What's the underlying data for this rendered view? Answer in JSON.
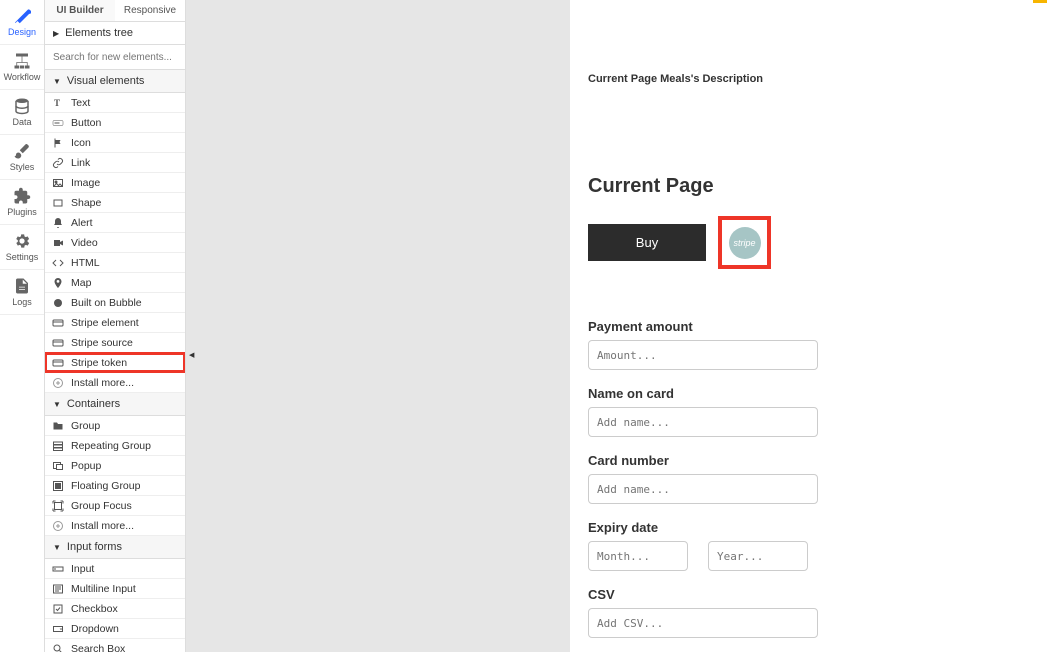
{
  "leftRail": [
    {
      "label": "Design",
      "icon": "tools",
      "active": true
    },
    {
      "label": "Workflow",
      "icon": "flow"
    },
    {
      "label": "Data",
      "icon": "database"
    },
    {
      "label": "Styles",
      "icon": "brush"
    },
    {
      "label": "Plugins",
      "icon": "puzzle"
    },
    {
      "label": "Settings",
      "icon": "gear"
    },
    {
      "label": "Logs",
      "icon": "file"
    }
  ],
  "tabs": {
    "uiBuilder": "UI Builder",
    "responsive": "Responsive"
  },
  "elementsTree": "Elements tree",
  "searchPlaceholder": "Search for new elements...",
  "groups": {
    "visual": "Visual elements",
    "containers": "Containers",
    "inputs": "Input forms"
  },
  "visualItems": [
    {
      "label": "Text",
      "icon": "text"
    },
    {
      "label": "Button",
      "icon": "button"
    },
    {
      "label": "Icon",
      "icon": "flag"
    },
    {
      "label": "Link",
      "icon": "link"
    },
    {
      "label": "Image",
      "icon": "image"
    },
    {
      "label": "Shape",
      "icon": "rect"
    },
    {
      "label": "Alert",
      "icon": "bell"
    },
    {
      "label": "Video",
      "icon": "video"
    },
    {
      "label": "HTML",
      "icon": "code"
    },
    {
      "label": "Map",
      "icon": "pin"
    },
    {
      "label": "Built on Bubble",
      "icon": "bubble"
    },
    {
      "label": "Stripe element",
      "icon": "card"
    },
    {
      "label": "Stripe source",
      "icon": "card"
    },
    {
      "label": "Stripe token",
      "icon": "card",
      "highlight": true
    },
    {
      "label": "Install more...",
      "icon": "plus"
    }
  ],
  "containerItems": [
    {
      "label": "Group",
      "icon": "folder"
    },
    {
      "label": "Repeating Group",
      "icon": "rgroup"
    },
    {
      "label": "Popup",
      "icon": "popup"
    },
    {
      "label": "Floating Group",
      "icon": "fgroup"
    },
    {
      "label": "Group Focus",
      "icon": "focus"
    },
    {
      "label": "Install more...",
      "icon": "plus"
    }
  ],
  "inputItems": [
    {
      "label": "Input",
      "icon": "input"
    },
    {
      "label": "Multiline Input",
      "icon": "mlinput"
    },
    {
      "label": "Checkbox",
      "icon": "check"
    },
    {
      "label": "Dropdown",
      "icon": "dropdown"
    },
    {
      "label": "Search Box",
      "icon": "search"
    }
  ],
  "canvas": {
    "description": "Current Page Meals's Description",
    "heading": "Current Page",
    "buy": "Buy",
    "stripeBadge": "stripe",
    "fields": {
      "paymentAmount": {
        "label": "Payment amount",
        "placeholder": "Amount..."
      },
      "nameOnCard": {
        "label": "Name on card",
        "placeholder": "Add name..."
      },
      "cardNumber": {
        "label": "Card number",
        "placeholder": "Add name..."
      },
      "expiry": {
        "label": "Expiry date",
        "monthPlaceholder": "Month...",
        "yearPlaceholder": "Year..."
      },
      "csv": {
        "label": "CSV",
        "placeholder": "Add CSV..."
      }
    }
  }
}
